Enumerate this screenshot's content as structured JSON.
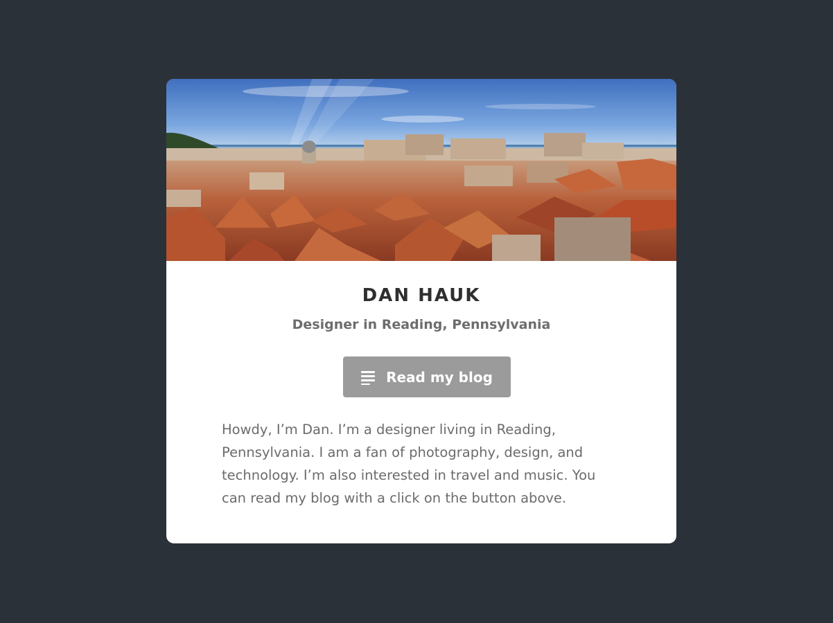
{
  "profile": {
    "name": "DAN HAUK",
    "subtitle": "Designer in Reading, Pennsylvania",
    "blog_button_label": "Read my blog",
    "blog_button_icon": "text-lines-icon",
    "bio_lines": [
      "Howdy, I’m Dan. I’m a designer living in Reading,",
      "Pennsylvania. I am a fan of photography, design, and",
      "technology. I’m also interested in travel and music. You",
      "can read my blog with a click on the button above."
    ]
  },
  "colors": {
    "page_background": "#2b3138",
    "card_background": "#ffffff",
    "button_background": "#9b9b9b",
    "name_text": "#2f2f2f",
    "subtitle_text": "#6d6d6d",
    "bio_text": "#6b6b6b"
  }
}
